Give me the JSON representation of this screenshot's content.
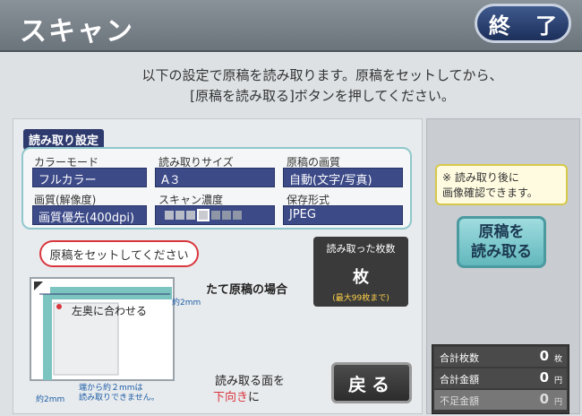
{
  "header": {
    "title": "スキャン",
    "end_label": "終 了"
  },
  "instructions": {
    "line1": "以下の設定で原稿を読み取ります。原稿をセットしてから、",
    "line2": "[原稿を読み取る]ボタンを押してください。"
  },
  "settings": {
    "heading": "読み取り設定",
    "color_mode": {
      "label": "カラーモード",
      "value": "フルカラー"
    },
    "read_size": {
      "label": "読み取りサイズ",
      "value": "A３"
    },
    "image_quality": {
      "label": "原稿の画質",
      "value": "自動(文字/写真)"
    },
    "resolution": {
      "label": "画質(解像度)",
      "value": "画質優先(400dpi)"
    },
    "density": {
      "label": "スキャン濃度",
      "selected_level": 4,
      "levels": 7
    },
    "format": {
      "label": "保存形式",
      "value": "JPEG"
    }
  },
  "placement": {
    "pill": "原稿をセットしてください",
    "portrait_note": "たて原稿の場合",
    "corner_label": "左奥に合わせる",
    "margin_right": "約2mm",
    "margin_bottom": "約2mm",
    "edge_note1": "端から約２mmは",
    "edge_note2": "読み取りできません。"
  },
  "count": {
    "title": "読み取った枚数",
    "unit": "枚",
    "note": "(最大99枚まで)"
  },
  "face": {
    "line1": "読み取る面を",
    "line2_red": "下向き",
    "line2_rest": "に"
  },
  "buttons": {
    "back": "戻る",
    "read_line1": "原稿を",
    "read_line2": "読み取る"
  },
  "confirm_note": {
    "line1": "※ 読み取り後に",
    "line2": "画像確認できます。"
  },
  "totals": [
    {
      "label": "合計枚数",
      "value": "0",
      "unit": "枚"
    },
    {
      "label": "合計金額",
      "value": "0",
      "unit": "円"
    },
    {
      "label": "不足金額",
      "value": "0",
      "unit": "円"
    }
  ],
  "colors": {
    "accent_red": "#d9363e",
    "settings_blue": "#3c4a88",
    "read_button": "#62b8bd"
  }
}
